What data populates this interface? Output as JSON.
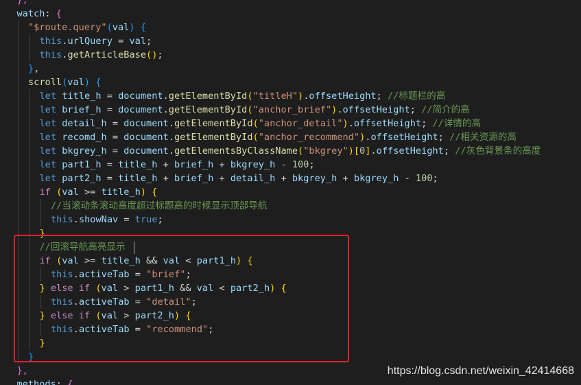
{
  "editor": {
    "language": "javascript",
    "colors": {
      "background": "#1e1e1e",
      "keyword": "#569cd6",
      "control": "#c586c0",
      "variable": "#9cdcfe",
      "function": "#dcdcaa",
      "string": "#ce9178",
      "number": "#b5cea8",
      "comment": "#6a9955",
      "highlight_box": "#e8202a"
    },
    "lines": [
      {
        "indent": 1,
        "tokens": [
          {
            "t": "},",
            "c": "b2"
          }
        ]
      },
      {
        "indent": 1,
        "tokens": [
          {
            "t": "watch",
            "c": "var"
          },
          {
            "t": ": ",
            "c": "punct"
          },
          {
            "t": "{",
            "c": "b2"
          }
        ]
      },
      {
        "indent": 2,
        "tokens": [
          {
            "t": "\"$route.query\"",
            "c": "str"
          },
          {
            "t": "(",
            "c": "b3"
          },
          {
            "t": "val",
            "c": "var"
          },
          {
            "t": ")",
            "c": "b3"
          },
          {
            "t": " ",
            "c": "punct"
          },
          {
            "t": "{",
            "c": "b3"
          }
        ]
      },
      {
        "indent": 3,
        "tokens": [
          {
            "t": "this",
            "c": "kw"
          },
          {
            "t": ".",
            "c": "punct"
          },
          {
            "t": "urlQuery",
            "c": "var"
          },
          {
            "t": " = ",
            "c": "punct"
          },
          {
            "t": "val",
            "c": "var"
          },
          {
            "t": ";",
            "c": "punct"
          }
        ]
      },
      {
        "indent": 3,
        "tokens": [
          {
            "t": "this",
            "c": "kw"
          },
          {
            "t": ".",
            "c": "punct"
          },
          {
            "t": "getArticleBase",
            "c": "fn"
          },
          {
            "t": "()",
            "c": "b1"
          },
          {
            "t": ";",
            "c": "punct"
          }
        ]
      },
      {
        "indent": 2,
        "tokens": [
          {
            "t": "}",
            "c": "b3"
          },
          {
            "t": ",",
            "c": "punct"
          }
        ]
      },
      {
        "indent": 2,
        "tokens": [
          {
            "t": "scroll",
            "c": "fn"
          },
          {
            "t": "(",
            "c": "b3"
          },
          {
            "t": "val",
            "c": "var"
          },
          {
            "t": ")",
            "c": "b3"
          },
          {
            "t": " ",
            "c": "punct"
          },
          {
            "t": "{",
            "c": "b3"
          }
        ]
      },
      {
        "indent": 3,
        "tokens": [
          {
            "t": "let ",
            "c": "kw"
          },
          {
            "t": "title_h",
            "c": "var"
          },
          {
            "t": " = ",
            "c": "punct"
          },
          {
            "t": "document",
            "c": "var"
          },
          {
            "t": ".",
            "c": "punct"
          },
          {
            "t": "getElementById",
            "c": "fn"
          },
          {
            "t": "(",
            "c": "b1"
          },
          {
            "t": "\"titleH\"",
            "c": "str"
          },
          {
            "t": ")",
            "c": "b1"
          },
          {
            "t": ".",
            "c": "punct"
          },
          {
            "t": "offsetHeight",
            "c": "var"
          },
          {
            "t": "; ",
            "c": "punct"
          },
          {
            "t": "//标题栏的高",
            "c": "cmt"
          }
        ]
      },
      {
        "indent": 3,
        "tokens": [
          {
            "t": "let ",
            "c": "kw"
          },
          {
            "t": "brief_h",
            "c": "var"
          },
          {
            "t": " = ",
            "c": "punct"
          },
          {
            "t": "document",
            "c": "var"
          },
          {
            "t": ".",
            "c": "punct"
          },
          {
            "t": "getElementById",
            "c": "fn"
          },
          {
            "t": "(",
            "c": "b1"
          },
          {
            "t": "\"anchor_brief\"",
            "c": "str"
          },
          {
            "t": ")",
            "c": "b1"
          },
          {
            "t": ".",
            "c": "punct"
          },
          {
            "t": "offsetHeight",
            "c": "var"
          },
          {
            "t": "; ",
            "c": "punct"
          },
          {
            "t": "//简介的高",
            "c": "cmt"
          }
        ]
      },
      {
        "indent": 3,
        "tokens": [
          {
            "t": "let ",
            "c": "kw"
          },
          {
            "t": "detail_h",
            "c": "var"
          },
          {
            "t": " = ",
            "c": "punct"
          },
          {
            "t": "document",
            "c": "var"
          },
          {
            "t": ".",
            "c": "punct"
          },
          {
            "t": "getElementById",
            "c": "fn"
          },
          {
            "t": "(",
            "c": "b1"
          },
          {
            "t": "\"anchor_detail\"",
            "c": "str"
          },
          {
            "t": ")",
            "c": "b1"
          },
          {
            "t": ".",
            "c": "punct"
          },
          {
            "t": "offsetHeight",
            "c": "var"
          },
          {
            "t": "; ",
            "c": "punct"
          },
          {
            "t": "//详情的高",
            "c": "cmt"
          }
        ]
      },
      {
        "indent": 3,
        "tokens": [
          {
            "t": "let ",
            "c": "kw"
          },
          {
            "t": "recomd_h",
            "c": "var"
          },
          {
            "t": " = ",
            "c": "punct"
          },
          {
            "t": "document",
            "c": "var"
          },
          {
            "t": ".",
            "c": "punct"
          },
          {
            "t": "getElementById",
            "c": "fn"
          },
          {
            "t": "(",
            "c": "b1"
          },
          {
            "t": "\"anchor_recommend\"",
            "c": "str"
          },
          {
            "t": ")",
            "c": "b1"
          },
          {
            "t": ".",
            "c": "punct"
          },
          {
            "t": "offsetHeight",
            "c": "var"
          },
          {
            "t": "; ",
            "c": "punct"
          },
          {
            "t": "//相关资源的高",
            "c": "cmt"
          }
        ]
      },
      {
        "indent": 3,
        "tokens": [
          {
            "t": "let ",
            "c": "kw"
          },
          {
            "t": "bkgrey_h",
            "c": "var"
          },
          {
            "t": " = ",
            "c": "punct"
          },
          {
            "t": "document",
            "c": "var"
          },
          {
            "t": ".",
            "c": "punct"
          },
          {
            "t": "getElementsByClassName",
            "c": "fn"
          },
          {
            "t": "(",
            "c": "b1"
          },
          {
            "t": "\"bkgrey\"",
            "c": "str"
          },
          {
            "t": ")",
            "c": "b1"
          },
          {
            "t": "[",
            "c": "b1"
          },
          {
            "t": "0",
            "c": "num"
          },
          {
            "t": "]",
            "c": "b1"
          },
          {
            "t": ".",
            "c": "punct"
          },
          {
            "t": "offsetHeight",
            "c": "var"
          },
          {
            "t": "; ",
            "c": "punct"
          },
          {
            "t": "//灰色背景条的高度",
            "c": "cmt"
          }
        ]
      },
      {
        "indent": 3,
        "tokens": [
          {
            "t": "let ",
            "c": "kw"
          },
          {
            "t": "part1_h",
            "c": "var"
          },
          {
            "t": " = ",
            "c": "punct"
          },
          {
            "t": "title_h",
            "c": "var"
          },
          {
            "t": " + ",
            "c": "punct"
          },
          {
            "t": "brief_h",
            "c": "var"
          },
          {
            "t": " + ",
            "c": "punct"
          },
          {
            "t": "bkgrey_h",
            "c": "var"
          },
          {
            "t": " - ",
            "c": "punct"
          },
          {
            "t": "100",
            "c": "num"
          },
          {
            "t": ";",
            "c": "punct"
          }
        ]
      },
      {
        "indent": 3,
        "tokens": [
          {
            "t": "let ",
            "c": "kw"
          },
          {
            "t": "part2_h",
            "c": "var"
          },
          {
            "t": " = ",
            "c": "punct"
          },
          {
            "t": "title_h",
            "c": "var"
          },
          {
            "t": " + ",
            "c": "punct"
          },
          {
            "t": "brief_h",
            "c": "var"
          },
          {
            "t": " + ",
            "c": "punct"
          },
          {
            "t": "detail_h",
            "c": "var"
          },
          {
            "t": " + ",
            "c": "punct"
          },
          {
            "t": "bkgrey_h",
            "c": "var"
          },
          {
            "t": " + ",
            "c": "punct"
          },
          {
            "t": "bkgrey_h",
            "c": "var"
          },
          {
            "t": " - ",
            "c": "punct"
          },
          {
            "t": "100",
            "c": "num"
          },
          {
            "t": ";",
            "c": "punct"
          }
        ]
      },
      {
        "indent": 3,
        "tokens": [
          {
            "t": "if",
            "c": "ctrl"
          },
          {
            "t": " ",
            "c": "punct"
          },
          {
            "t": "(",
            "c": "b1"
          },
          {
            "t": "val",
            "c": "var"
          },
          {
            "t": " >= ",
            "c": "punct"
          },
          {
            "t": "title_h",
            "c": "var"
          },
          {
            "t": ")",
            "c": "b1"
          },
          {
            "t": " ",
            "c": "punct"
          },
          {
            "t": "{",
            "c": "b1"
          }
        ]
      },
      {
        "indent": 4,
        "tokens": [
          {
            "t": "//当滚动条滚动高度超过标题高的时候显示顶部导航",
            "c": "cmt"
          }
        ]
      },
      {
        "indent": 4,
        "tokens": [
          {
            "t": "this",
            "c": "kw"
          },
          {
            "t": ".",
            "c": "punct"
          },
          {
            "t": "showNav",
            "c": "var"
          },
          {
            "t": " = ",
            "c": "punct"
          },
          {
            "t": "true",
            "c": "kw"
          },
          {
            "t": ";",
            "c": "punct"
          }
        ]
      },
      {
        "indent": 3,
        "tokens": [
          {
            "t": "}",
            "c": "b1"
          }
        ]
      },
      {
        "indent": 3,
        "tokens": [
          {
            "t": "//回滚导航高亮显示",
            "c": "cmt"
          }
        ]
      },
      {
        "indent": 3,
        "tokens": [
          {
            "t": "if",
            "c": "ctrl"
          },
          {
            "t": " ",
            "c": "punct"
          },
          {
            "t": "(",
            "c": "b1"
          },
          {
            "t": "val",
            "c": "var"
          },
          {
            "t": " >= ",
            "c": "punct"
          },
          {
            "t": "title_h",
            "c": "var"
          },
          {
            "t": " && ",
            "c": "punct"
          },
          {
            "t": "val",
            "c": "var"
          },
          {
            "t": " < ",
            "c": "punct"
          },
          {
            "t": "part1_h",
            "c": "var"
          },
          {
            "t": ")",
            "c": "b1"
          },
          {
            "t": " ",
            "c": "punct"
          },
          {
            "t": "{",
            "c": "b1"
          }
        ]
      },
      {
        "indent": 4,
        "tokens": [
          {
            "t": "this",
            "c": "kw"
          },
          {
            "t": ".",
            "c": "punct"
          },
          {
            "t": "activeTab",
            "c": "var"
          },
          {
            "t": " = ",
            "c": "punct"
          },
          {
            "t": "\"brief\"",
            "c": "str"
          },
          {
            "t": ";",
            "c": "punct"
          }
        ]
      },
      {
        "indent": 3,
        "tokens": [
          {
            "t": "}",
            "c": "b1"
          },
          {
            "t": " ",
            "c": "punct"
          },
          {
            "t": "else if",
            "c": "ctrl"
          },
          {
            "t": " ",
            "c": "punct"
          },
          {
            "t": "(",
            "c": "b1"
          },
          {
            "t": "val",
            "c": "var"
          },
          {
            "t": " > ",
            "c": "punct"
          },
          {
            "t": "part1_h",
            "c": "var"
          },
          {
            "t": " && ",
            "c": "punct"
          },
          {
            "t": "val",
            "c": "var"
          },
          {
            "t": " < ",
            "c": "punct"
          },
          {
            "t": "part2_h",
            "c": "var"
          },
          {
            "t": ")",
            "c": "b1"
          },
          {
            "t": " ",
            "c": "punct"
          },
          {
            "t": "{",
            "c": "b1"
          }
        ]
      },
      {
        "indent": 4,
        "tokens": [
          {
            "t": "this",
            "c": "kw"
          },
          {
            "t": ".",
            "c": "punct"
          },
          {
            "t": "activeTab",
            "c": "var"
          },
          {
            "t": " = ",
            "c": "punct"
          },
          {
            "t": "\"detail\"",
            "c": "str"
          },
          {
            "t": ";",
            "c": "punct"
          }
        ]
      },
      {
        "indent": 3,
        "tokens": [
          {
            "t": "}",
            "c": "b1"
          },
          {
            "t": " ",
            "c": "punct"
          },
          {
            "t": "else if",
            "c": "ctrl"
          },
          {
            "t": " ",
            "c": "punct"
          },
          {
            "t": "(",
            "c": "b1"
          },
          {
            "t": "val",
            "c": "var"
          },
          {
            "t": " > ",
            "c": "punct"
          },
          {
            "t": "part2_h",
            "c": "var"
          },
          {
            "t": ")",
            "c": "b1"
          },
          {
            "t": " ",
            "c": "punct"
          },
          {
            "t": "{",
            "c": "b1"
          }
        ]
      },
      {
        "indent": 4,
        "tokens": [
          {
            "t": "this",
            "c": "kw"
          },
          {
            "t": ".",
            "c": "punct"
          },
          {
            "t": "activeTab",
            "c": "var"
          },
          {
            "t": " = ",
            "c": "punct"
          },
          {
            "t": "\"recommend\"",
            "c": "str"
          },
          {
            "t": ";",
            "c": "punct"
          }
        ]
      },
      {
        "indent": 3,
        "tokens": [
          {
            "t": "}",
            "c": "b1"
          }
        ]
      },
      {
        "indent": 2,
        "tokens": [
          {
            "t": "}",
            "c": "b3"
          }
        ]
      },
      {
        "indent": 1,
        "tokens": [
          {
            "t": "},",
            "c": "b2"
          }
        ]
      },
      {
        "indent": 1,
        "tokens": [
          {
            "t": "methods",
            "c": "var"
          },
          {
            "t": ": ",
            "c": "punct"
          },
          {
            "t": "{",
            "c": "b2"
          }
        ]
      }
    ]
  },
  "watermark": {
    "text": "https://blog.csdn.net/weixin_42414668"
  }
}
